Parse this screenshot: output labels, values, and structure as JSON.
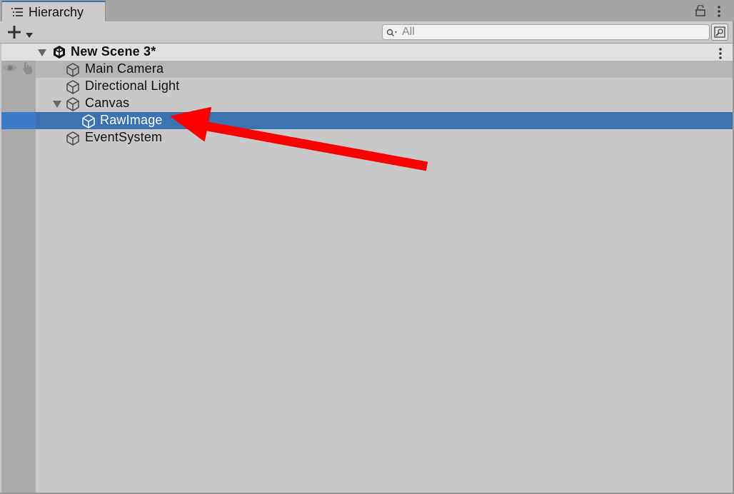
{
  "window": {
    "tab_label": "Hierarchy"
  },
  "toolbar": {
    "add_icon": "plus-icon",
    "search_placeholder": "All"
  },
  "hierarchy": {
    "scene": {
      "label": "New Scene 3*",
      "expanded": true
    },
    "items": [
      {
        "label": "Main Camera",
        "depth": 0,
        "state": "hovered"
      },
      {
        "label": "Directional Light",
        "depth": 0,
        "state": "normal"
      },
      {
        "label": "Canvas",
        "depth": 0,
        "state": "normal",
        "expanded": true
      },
      {
        "label": "RawImage",
        "depth": 1,
        "state": "selected"
      },
      {
        "label": "EventSystem",
        "depth": 0,
        "state": "normal"
      }
    ]
  },
  "annotation": {
    "arrow_color": "#ff0000",
    "points_to": "RawImage"
  },
  "colors": {
    "selection": "#3b72b2",
    "accent": "#3a72b0"
  }
}
